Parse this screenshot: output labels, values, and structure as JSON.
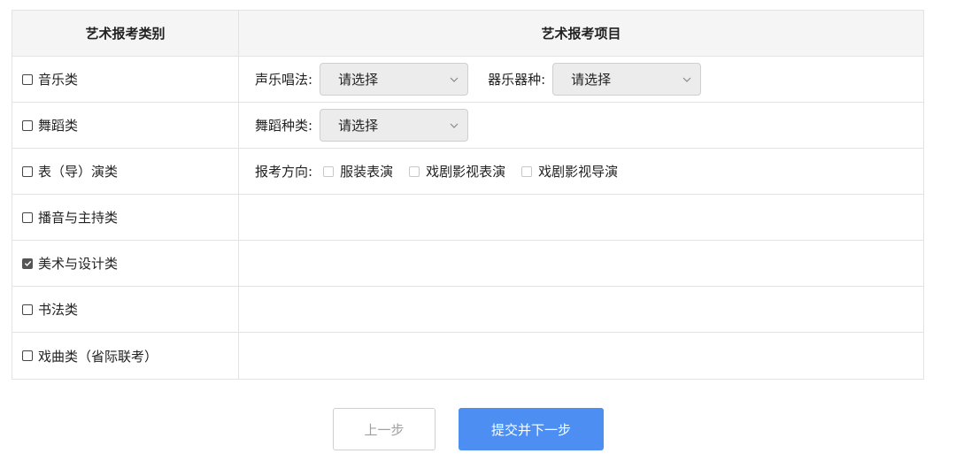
{
  "table": {
    "header": {
      "category": "艺术报考类别",
      "project": "艺术报考项目"
    },
    "rows": [
      {
        "label": "音乐类",
        "checked": false,
        "right": {
          "vocal_label": "声乐唱法:",
          "vocal_select": "请选择",
          "instrument_label": "器乐器种:",
          "instrument_select": "请选择"
        }
      },
      {
        "label": "舞蹈类",
        "checked": false,
        "right": {
          "dance_label": "舞蹈种类:",
          "dance_select": "请选择"
        }
      },
      {
        "label": "表（导）演类",
        "checked": false,
        "right": {
          "direction_label": "报考方向:",
          "options": [
            "服装表演",
            "戏剧影视表演",
            "戏剧影视导演"
          ]
        }
      },
      {
        "label": "播音与主持类",
        "checked": false
      },
      {
        "label": "美术与设计类",
        "checked": true
      },
      {
        "label": "书法类",
        "checked": false
      },
      {
        "label": "戏曲类（省际联考）",
        "checked": false
      }
    ]
  },
  "buttons": {
    "prev_label": "上一步",
    "next_label": "提交并下一步"
  },
  "colors": {
    "primary": "#4c8ef2",
    "header_bg": "#f5f5f5",
    "border": "#e3e3e3",
    "select_bg": "#ececec"
  }
}
